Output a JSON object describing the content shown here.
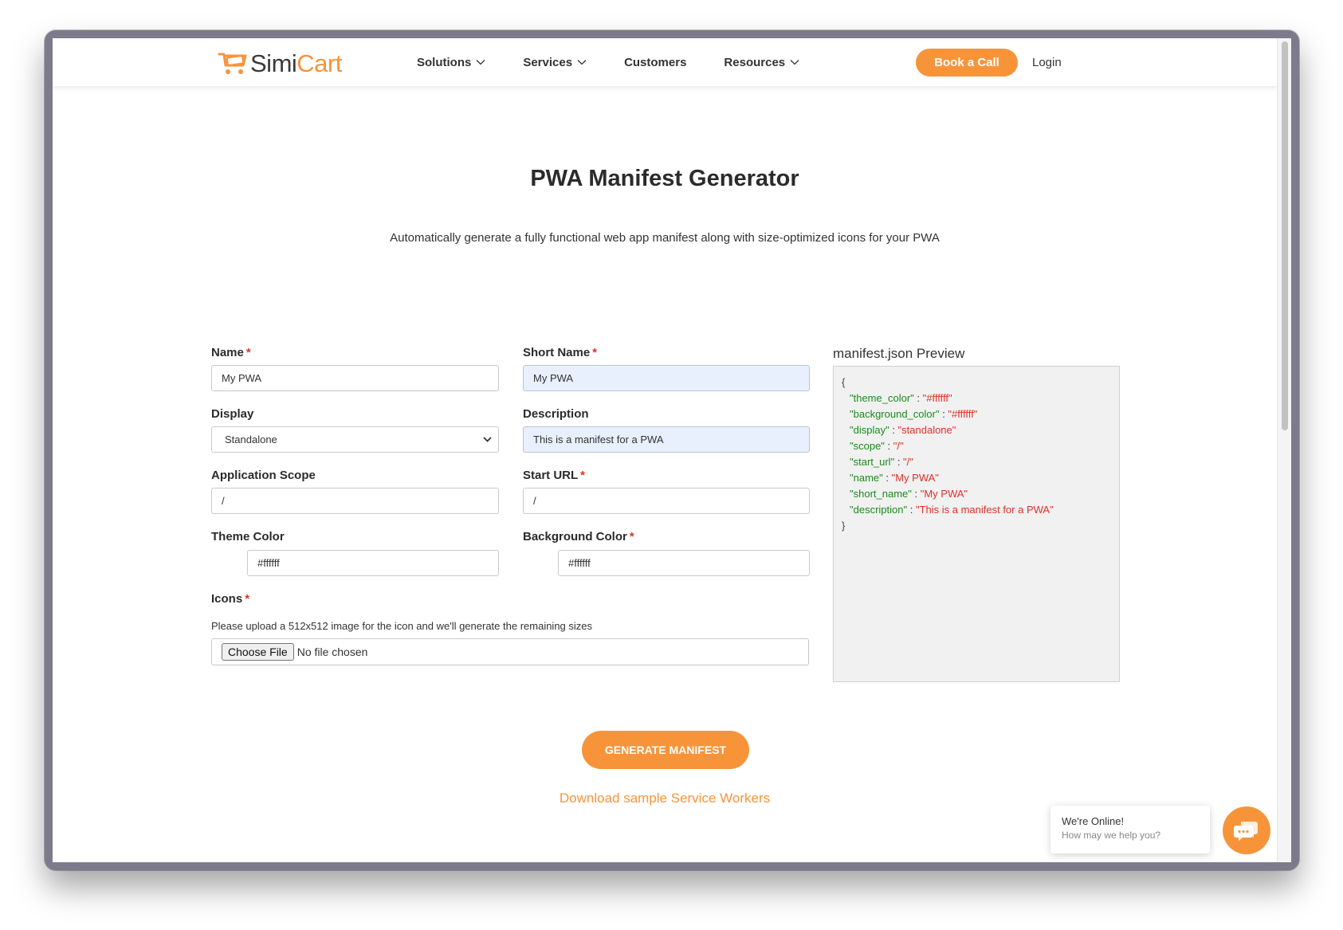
{
  "header": {
    "logo": {
      "simi": "Simi",
      "cart": "Cart"
    },
    "nav": [
      {
        "label": "Solutions",
        "has_dropdown": true
      },
      {
        "label": "Services",
        "has_dropdown": true
      },
      {
        "label": "Customers",
        "has_dropdown": false
      },
      {
        "label": "Resources",
        "has_dropdown": true
      }
    ],
    "book_call_label": "Book a Call",
    "login_label": "Login"
  },
  "main": {
    "title": "PWA Manifest Generator",
    "subtitle": "Automatically generate a fully functional web app manifest along with size-optimized icons for your PWA"
  },
  "form": {
    "name": {
      "label": "Name",
      "required": "*",
      "value": "My PWA"
    },
    "short_name": {
      "label": "Short Name",
      "required": "*",
      "value": "My PWA"
    },
    "display": {
      "label": "Display",
      "value": "Standalone"
    },
    "description": {
      "label": "Description",
      "value": "This is a manifest for a PWA"
    },
    "application_scope": {
      "label": "Application Scope",
      "value": "/"
    },
    "start_url": {
      "label": "Start URL",
      "required": "*",
      "value": "/"
    },
    "theme_color": {
      "label": "Theme Color",
      "value": "#ffffff"
    },
    "background_color": {
      "label": "Background Color",
      "required": "*",
      "value": "#ffffff"
    },
    "icons": {
      "label": "Icons",
      "required": "*",
      "hint": "Please upload a 512x512 image for the icon and we'll generate the remaining sizes",
      "choose_file": "Choose File",
      "no_file": "No file chosen"
    }
  },
  "preview": {
    "title": "manifest.json Preview",
    "open_brace": "{",
    "close_brace": "}",
    "entries": [
      {
        "key": "\"theme_color\"",
        "sep": " : ",
        "value": "\"#ffffff\""
      },
      {
        "key": "\"background_color\"",
        "sep": " : ",
        "value": "\"#ffffff\""
      },
      {
        "key": "\"display\"",
        "sep": " : ",
        "value": "\"standalone\""
      },
      {
        "key": "\"scope\"",
        "sep": " : ",
        "value": "\"/\""
      },
      {
        "key": "\"start_url\"",
        "sep": " : ",
        "value": "\"/\""
      },
      {
        "key": "\"name\"",
        "sep": " : ",
        "value": "\"My PWA\""
      },
      {
        "key": "\"short_name\"",
        "sep": " : ",
        "value": "\"My PWA\""
      },
      {
        "key": "\"description\"",
        "sep": " : ",
        "value": "\"This is a manifest for a PWA\""
      }
    ]
  },
  "actions": {
    "generate_label": "GENERATE MANIFEST",
    "download_link": "Download sample Service Workers"
  },
  "chat": {
    "online": "We're Online!",
    "help": "How may we help you?",
    "icon": "chat-bubbles-icon"
  },
  "colors": {
    "accent": "#f7943a",
    "json_key": "#1a8a1a",
    "json_value": "#e0302a",
    "required": "#e0302a"
  }
}
